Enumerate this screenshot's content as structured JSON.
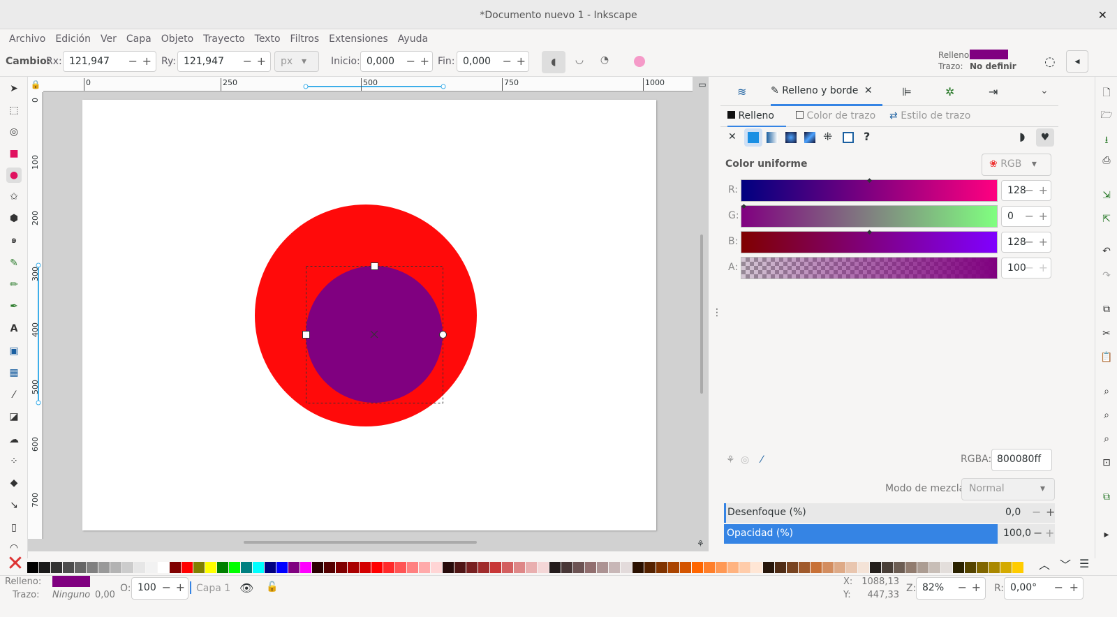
{
  "window": {
    "title": "*Documento nuevo 1 - Inkscape",
    "close_label": "✕"
  },
  "menu": [
    "Archivo",
    "Edición",
    "Ver",
    "Capa",
    "Objeto",
    "Trayecto",
    "Texto",
    "Filtros",
    "Extensiones",
    "Ayuda"
  ],
  "tool_controls": {
    "change_label": "Cambio:",
    "rx_label": "Rx:",
    "rx_value": "121,947",
    "ry_label": "Ry:",
    "ry_value": "121,947",
    "unit": "px",
    "start_label": "Inicio:",
    "start_value": "0,000",
    "end_label": "Fin:",
    "end_value": "0,000"
  },
  "style_indicator": {
    "fill_label": "Relleno:",
    "stroke_label": "Trazo:",
    "stroke_value": "No definir",
    "fill_color": "#800080"
  },
  "rulers": {
    "horizontal": [
      "0",
      "250",
      "500",
      "750",
      "1000"
    ],
    "vertical": [
      "0",
      "100",
      "200",
      "300",
      "400",
      "500",
      "600",
      "700"
    ]
  },
  "canvas": {
    "outer_circle_color": "#ff0a0a",
    "inner_circle_color": "#800080"
  },
  "panel": {
    "tab_title": "Relleno y borde",
    "subtabs": [
      "Relleno",
      "Color de trazo",
      "Estilo de trazo"
    ],
    "flat_color_label": "Color uniforme",
    "color_mode": "RGB",
    "channels": [
      {
        "label": "R:",
        "value": "128"
      },
      {
        "label": "G:",
        "value": "0"
      },
      {
        "label": "B:",
        "value": "128"
      },
      {
        "label": "A:",
        "value": "100"
      }
    ],
    "rgba_label": "RGBA:",
    "rgba_value": "800080ff",
    "blend_label": "Modo de mezcla:",
    "blend_value": "Normal",
    "blur_label": "Desenfoque (%)",
    "blur_value": "0,0",
    "opacity_label": "Opacidad (%)",
    "opacity_value": "100,0"
  },
  "palette": [
    "#000000",
    "#1a1a1a",
    "#333333",
    "#4d4d4d",
    "#666666",
    "#808080",
    "#999999",
    "#b3b3b3",
    "#cccccc",
    "#e6e6e6",
    "#f2f2f2",
    "#ffffff",
    "#800000",
    "#ff0000",
    "#808000",
    "#ffff00",
    "#008000",
    "#00ff00",
    "#008080",
    "#00ffff",
    "#000080",
    "#0000ff",
    "#800080",
    "#ff00ff",
    "#2b0000",
    "#550000",
    "#800000",
    "#aa0000",
    "#d40000",
    "#ff0000",
    "#ff2a2a",
    "#ff5555",
    "#ff8080",
    "#ffaaaa",
    "#ffd5d5",
    "#280b0b",
    "#501616",
    "#782121",
    "#a02c2c",
    "#c83737",
    "#d35f5f",
    "#de8787",
    "#e9afaf",
    "#f4d7d7",
    "#241c1c",
    "#483737",
    "#6c5353",
    "#916f6f",
    "#ac9393",
    "#c8b7b7",
    "#e3dbdb",
    "#2b1100",
    "#552200",
    "#803300",
    "#aa4400",
    "#d45500",
    "#ff6600",
    "#ff7f2a",
    "#ff9955",
    "#ffb380",
    "#ffccaa",
    "#ffe6d5",
    "#28170b",
    "#502d16",
    "#784421",
    "#a05a2c",
    "#c87137",
    "#d38d5f",
    "#deaa87",
    "#e9c6af",
    "#f4e3d7",
    "#241f1c",
    "#483e37",
    "#6c5d53",
    "#917c6f",
    "#ac9d93",
    "#c8beb7",
    "#e3dedb",
    "#2b2200",
    "#554400",
    "#806600",
    "#aa8800",
    "#d4aa00",
    "#ffcc00"
  ],
  "status": {
    "fill_label": "Relleno:",
    "stroke_label": "Trazo:",
    "stroke_value": "Ninguno",
    "stroke_width": "0,00",
    "opacity_label": "O:",
    "opacity_value": "100",
    "layer": "Capa 1",
    "x_label": "X:",
    "x_value": "1088,13",
    "y_label": "Y:",
    "y_value": "447,33",
    "zoom_label": "Z:",
    "zoom_value": "82%",
    "rotation_label": "R:",
    "rotation_value": "0,00°"
  }
}
